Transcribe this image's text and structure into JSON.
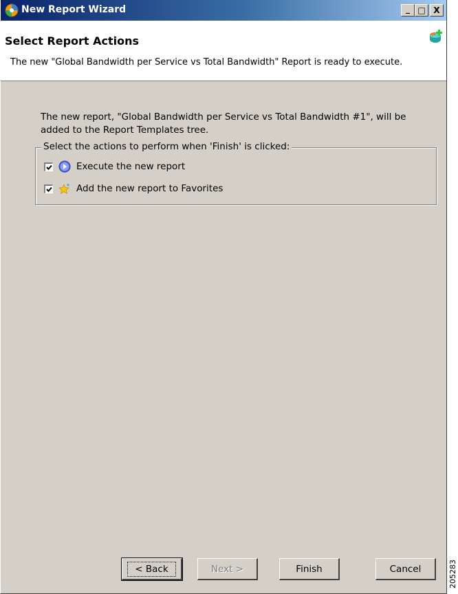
{
  "window": {
    "title": "New Report Wizard",
    "controls": {
      "minimize": "_",
      "maximize": "□",
      "close": "X"
    }
  },
  "header": {
    "title": "Select Report Actions",
    "description": "The new \"Global Bandwidth per Service vs Total Bandwidth\" Report is ready to execute.",
    "icon": "report-add-icon"
  },
  "body": {
    "intro": "The new report, \"Global Bandwidth per Service vs Total Bandwidth #1\", will be added to the Report Templates tree.",
    "group_label": "Select the actions to perform when 'Finish' is clicked:",
    "actions": [
      {
        "label": "Execute the new report",
        "checked": true,
        "icon": "execute-icon"
      },
      {
        "label": "Add the new report to Favorites",
        "checked": true,
        "icon": "favorites-star-icon"
      }
    ]
  },
  "buttons": {
    "back": "< Back",
    "next": "Next >",
    "finish": "Finish",
    "cancel": "Cancel"
  },
  "figure_id": "205283",
  "colors": {
    "titlebar_start": "#0a246a",
    "titlebar_end": "#a6caf0",
    "dialog_bg": "#d4d0c8",
    "header_bg": "#ffffff"
  }
}
